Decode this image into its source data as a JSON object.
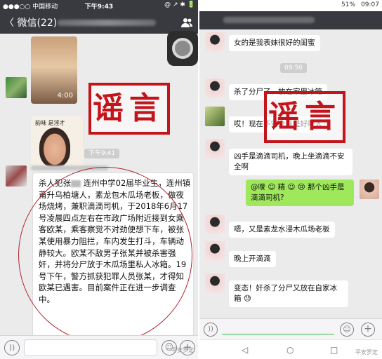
{
  "left": {
    "status": {
      "carrier": "●●●○○ 中国移动",
      "time": "下午9:43",
      "icons": "@ ↗ ✱ 🔋"
    },
    "nav": {
      "back_label": "〈 微信(22)"
    },
    "video": {
      "duration": "4:00"
    },
    "sticker_caption": "韵味   是淫才",
    "stamp_text": "谣言",
    "time_label": "下午9:41",
    "message": {
      "before_name": "杀人犯张",
      "after_name": "连州中学02届毕业生，连州镇莆升乌柏塘人，素龙包木瓜场老板，做夜场烧烤，兼职滴滴司机，于2018年6月17号凌晨四点左右在市政广场附近接到女乘客欧某，乘客察觉不对劲便想下车，被张某使用暴力阻拦，车内发生打斗，车辆动静较大。欧某不敌男子张某并被杀害强奸，并将分尸放于木瓜场里私人冰箱。19号下午，警方抓获犯罪人员张某，才得知欧某已遇害。目前案件正在进一步调查中。"
    },
    "input": {
      "voice_icon": "))",
      "emoji_icon": "☺",
      "plus_icon": "+"
    },
    "watermark": "平安罗定"
  },
  "right": {
    "status": {
      "battery": "51%",
      "time": "09:07"
    },
    "messages": [
      {
        "text": "女的是我表妹很好的闺蜜"
      },
      {
        "text": "杀了分尸了，放在家里冰箱"
      },
      {
        "text": "哎！现在不安全真是好吓人"
      },
      {
        "text": "凶手是滴滴司机，晚上坐滴滴不安全啊"
      },
      {
        "text": "@嘜 ☺ 精 ☺ 😢 那个凶手是滴滴司机?"
      },
      {
        "text": "嗯，又是素龙水浸木瓜场老板"
      },
      {
        "text": "晚上开滴滴"
      },
      {
        "text": "变态！奸杀了分尸又放在自家冰箱 😓"
      }
    ],
    "time_label": "09:50",
    "stamp_text": "谣言",
    "input": {
      "voice_icon": "))",
      "emoji_icon": "☺",
      "plus_icon": "+"
    },
    "softkeys": {
      "back": "◁",
      "home": "○",
      "recent": "□"
    },
    "watermark": "平安罗定"
  }
}
